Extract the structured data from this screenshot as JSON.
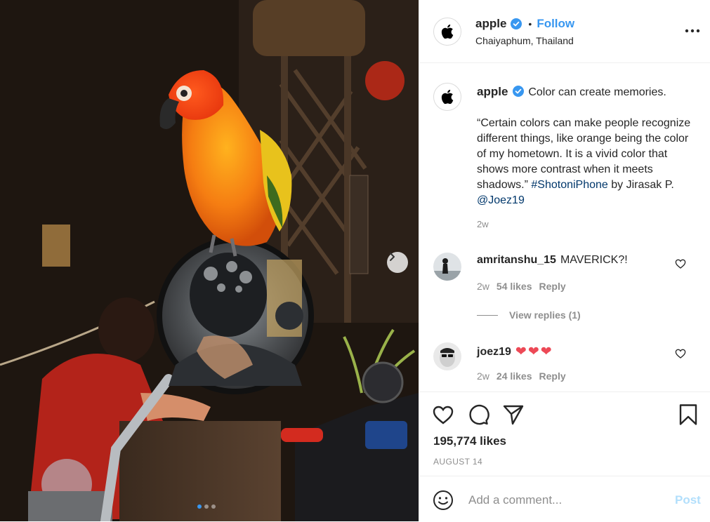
{
  "post": {
    "author": "apple",
    "verified": true,
    "follow_label": "Follow",
    "bullet": "•",
    "location": "Chaiyaphum, Thailand",
    "more_icon": "more-horizontal-icon"
  },
  "caption": {
    "username": "apple",
    "headline": "Color can create memories.",
    "quote": "“Certain colors can make people recognize different things, like orange being the color of my hometown. It is a vivid color that shows more contrast when it meets shadows.”",
    "hashtag": "#ShotoniPhone",
    "by_text": " by Jirasak P. ",
    "mention": "@Joez19",
    "time": "2w"
  },
  "comments": [
    {
      "username": "amritanshu_15",
      "text": "MAVERICK?!",
      "time": "2w",
      "likes": "54 likes",
      "reply_label": "Reply"
    },
    {
      "username": "joez19",
      "text": "❤❤❤",
      "time": "2w",
      "likes": "24 likes",
      "reply_label": "Reply"
    }
  ],
  "view_replies": "View replies (1)",
  "likes": "195,774 likes",
  "date": "AUGUST 14",
  "add_comment": {
    "placeholder": "Add a comment...",
    "post_label": "Post"
  },
  "carousel": {
    "slides": 3,
    "active": 1
  },
  "colors": {
    "link_blue": "#3897f0",
    "hashtag_blue": "#00376b",
    "muted": "#8e8e8e",
    "post_disabled": "#b2dffc",
    "heart_red": "#ed4956"
  }
}
